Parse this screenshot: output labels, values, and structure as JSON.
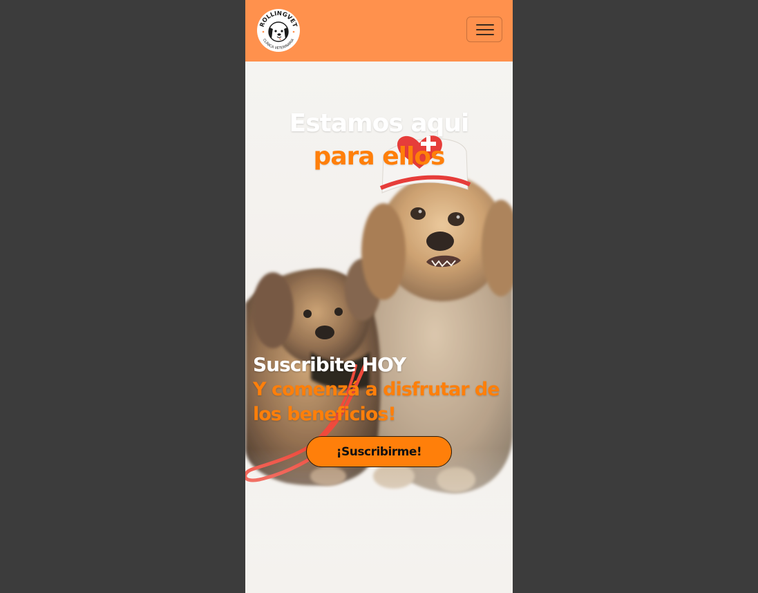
{
  "navbar": {
    "logo_text_top": "ROLLINGVET",
    "logo_text_bottom": "CLÍNICA VETERINARIA",
    "menu_icon": "hamburger-menu-icon",
    "background_color": "#ff914d"
  },
  "hero": {
    "headline_line1": "Estamos aqui",
    "headline_line2": "para ellos",
    "cta_title": "Suscribite HOY",
    "cta_subtitle": "Y comenzá a disfrutar de los beneficios!",
    "button_label": "¡Suscribirme!",
    "accent_color": "#ff7f0a"
  }
}
